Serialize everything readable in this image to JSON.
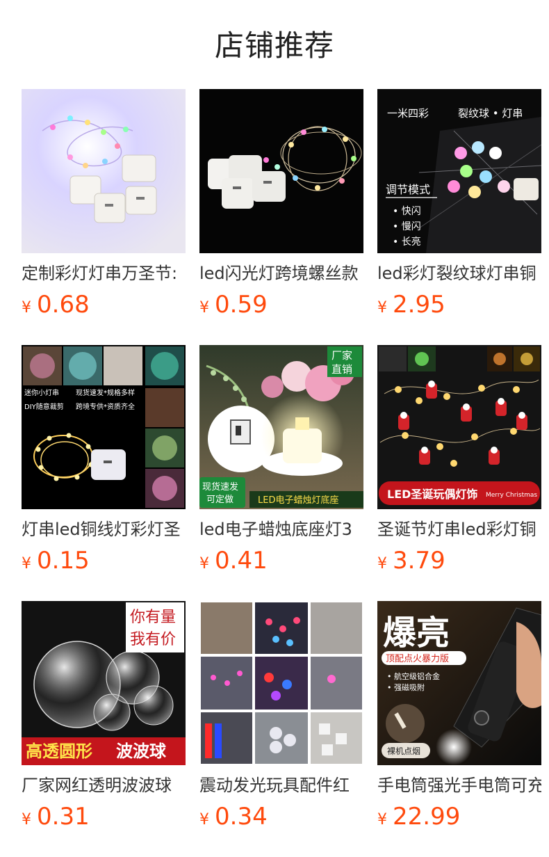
{
  "section": {
    "title": "店铺推荐"
  },
  "currency_symbol": "¥",
  "colors": {
    "price": "#ff4a0d",
    "title": "#222222",
    "product_name": "#333333"
  },
  "products": [
    {
      "name": "定制彩灯灯串万圣节:",
      "price": "0.68",
      "image_icon": "fairy-lights-photo",
      "image_text": []
    },
    {
      "name": "led闪光灯跨境螺丝款",
      "price": "0.59",
      "image_icon": "fairy-lights-dark-photo",
      "image_text": []
    },
    {
      "name": "led彩灯裂纹球灯串铜",
      "price": "2.95",
      "image_icon": "crackle-ball-lights-photo",
      "image_text": [
        "一米四彩",
        "裂纹球 • 灯串",
        "调节模式",
        "• 快闪",
        "• 慢闪",
        "• 长亮"
      ]
    },
    {
      "name": "灯串led铜线灯彩灯圣",
      "price": "0.15",
      "image_icon": "copper-wire-lights-collage",
      "image_text": [
        "迷你小灯串",
        "现货速发*规格多样",
        "DIY随意裁剪",
        "跨境专供*资质齐全"
      ]
    },
    {
      "name": "led电子蜡烛底座灯3",
      "price": "0.41",
      "image_icon": "candle-base-light-photo",
      "image_text": [
        "厂家",
        "直销",
        "现货速发",
        "可定做",
        "LED电子蜡烛灯底座"
      ]
    },
    {
      "name": "圣诞节灯串led彩灯铜",
      "price": "3.79",
      "image_icon": "santa-lights-photo",
      "image_text": [
        "LED圣诞玩偶灯饰",
        "Merry Christmas"
      ]
    },
    {
      "name": "厂家网红透明波波球",
      "price": "0.31",
      "image_icon": "clear-bobo-balls-photo",
      "image_text": [
        "你有量",
        "我有价",
        "高透圆形",
        "波波球"
      ]
    },
    {
      "name": "震动发光玩具配件红",
      "price": "0.34",
      "image_icon": "led-toy-parts-collage",
      "image_text": []
    },
    {
      "name": "手电筒强光手电筒可充",
      "price": "22.99",
      "image_icon": "flashlight-photo",
      "image_text": [
        "爆亮",
        "顶配点火暴力版",
        "• 航空级铝合金",
        "• 强磁吸附",
        "裸机点烟"
      ]
    }
  ]
}
